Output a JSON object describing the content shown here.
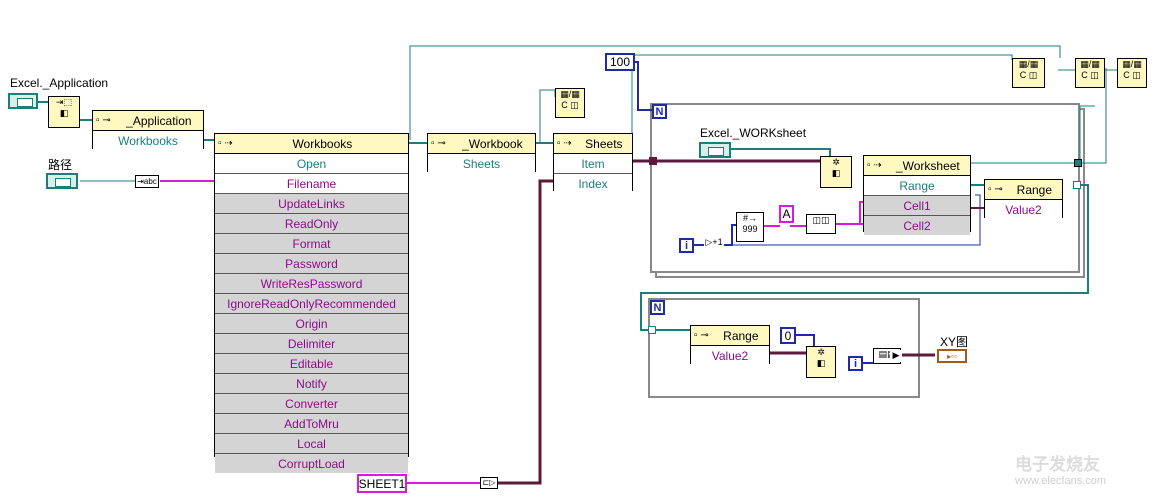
{
  "labels": {
    "excel_application": "Excel._Application",
    "path": "路径",
    "excel_worksheet": "Excel._WORKsheet",
    "xy_graph": "XY图",
    "watermark": "电子发烧友",
    "watermark_url": "www.elecfans.com"
  },
  "constants": {
    "hundred": "100",
    "sheet1": "SHEET1",
    "letter_a": "A",
    "zero": "0",
    "n": "N",
    "i": "i"
  },
  "nodes": {
    "application": {
      "title": "_Application",
      "rows": [
        "Workbooks"
      ]
    },
    "workbooks": {
      "title": "Workbooks",
      "rows": [
        "Open",
        "Filename",
        "UpdateLinks",
        "ReadOnly",
        "Format",
        "Password",
        "WriteResPassword",
        "IgnoreReadOnlyRecommended",
        "Origin",
        "Delimiter",
        "Editable",
        "Notify",
        "Converter",
        "AddToMru",
        "Local",
        "CorruptLoad"
      ]
    },
    "workbook": {
      "title": "_Workbook",
      "rows": [
        "Sheets"
      ]
    },
    "sheets": {
      "title": "Sheets",
      "rows": [
        "Item",
        "Index"
      ]
    },
    "worksheet": {
      "title": "_Worksheet",
      "rows": [
        "Range",
        "Cell1",
        "Cell2"
      ]
    },
    "range1": {
      "title": "Range",
      "rows": [
        "Value2"
      ]
    },
    "range2": {
      "title": "Range",
      "rows": [
        "Value2"
      ]
    }
  },
  "colors": {
    "refnum": "#1d7c7c",
    "string": "#d81bd8",
    "numeric": "#1f2aa8",
    "variant": "#5c1a3d",
    "node_header": "#fff8c0"
  }
}
